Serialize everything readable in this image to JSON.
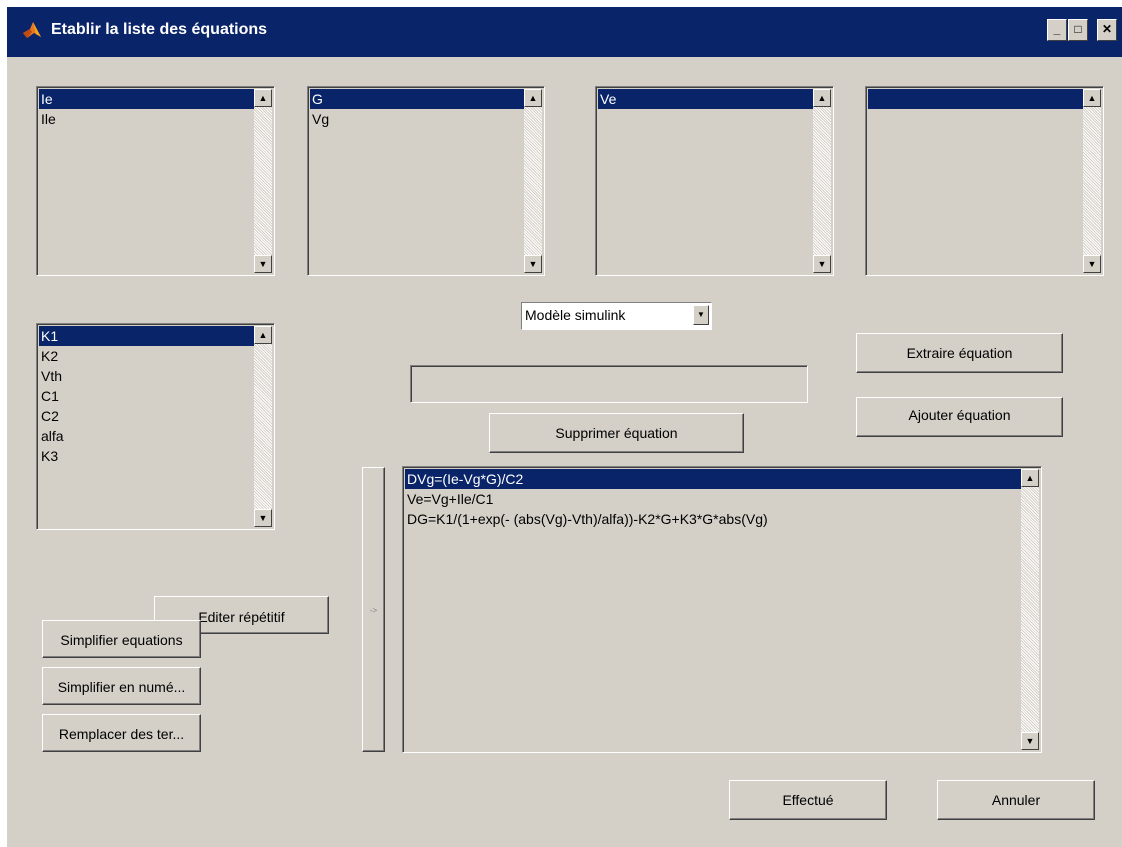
{
  "window": {
    "title": "Etablir la liste des équations",
    "controls": {
      "minimize": "_",
      "maximize": "□",
      "close": "✕"
    }
  },
  "lists": {
    "list1": {
      "items": [
        "Ie",
        "Ile"
      ],
      "selected": 0
    },
    "list2": {
      "items": [
        "G",
        "Vg"
      ],
      "selected": 0
    },
    "list3": {
      "items": [
        "Ve"
      ],
      "selected": 0
    },
    "list4": {
      "items": [
        ""
      ],
      "selected": 0
    },
    "constants": {
      "items": [
        "K1",
        "K2",
        "Vth",
        "C1",
        "C2",
        "alfa",
        "K3"
      ],
      "selected": 0
    },
    "equations": {
      "items": [
        "DVg=(Ie-Vg*G)/C2",
        "Ve=Vg+Ile/C1",
        "DG=K1/(1+exp(- (abs(Vg)-Vth)/alfa))-K2*G+K3*G*abs(Vg)"
      ],
      "selected": 0
    }
  },
  "model_select": {
    "value": "Modèle simulink",
    "arrow": "▼"
  },
  "equation_input": {
    "value": ""
  },
  "buttons": {
    "extraire": "Extraire équation",
    "ajouter": "Ajouter équation",
    "supprimer": "Supprimer équation",
    "editer": "Editer répétitif",
    "simplifier": "Simplifier equations",
    "simplifier_num": "Simplifier en numé...",
    "remplacer": "Remplacer des ter...",
    "transfer": "->",
    "effectue": "Effectué",
    "annuler": "Annuler"
  },
  "scroll": {
    "up": "▲",
    "down": "▼"
  },
  "colors": {
    "selection": "#0a246a",
    "face": "#d4d0c8",
    "title": "#0a246a"
  }
}
